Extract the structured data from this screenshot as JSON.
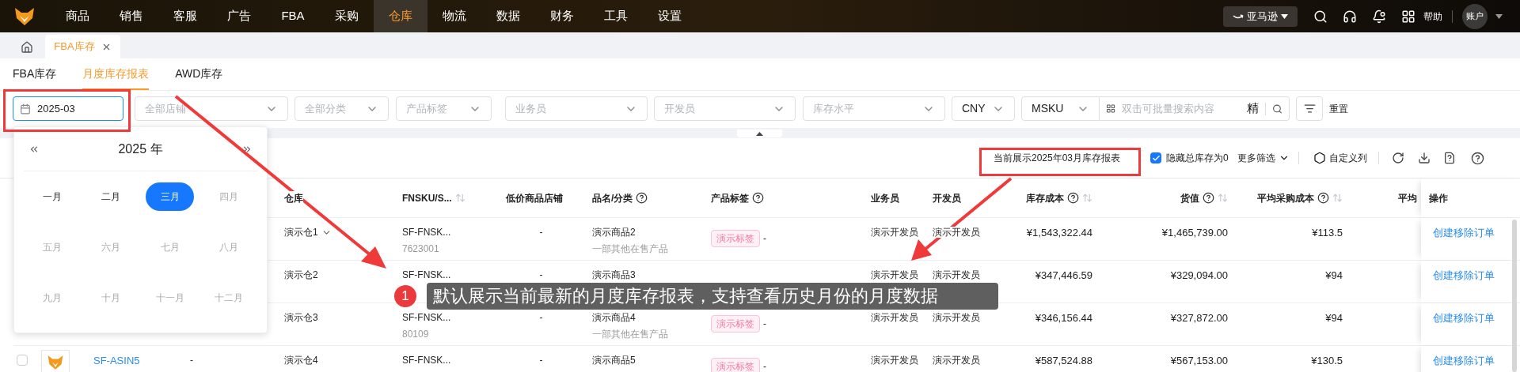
{
  "nav": {
    "items": [
      {
        "label": "商品",
        "selected": false
      },
      {
        "label": "销售",
        "selected": false
      },
      {
        "label": "客服",
        "selected": false
      },
      {
        "label": "广告",
        "selected": false
      },
      {
        "label": "FBA",
        "selected": false
      },
      {
        "label": "采购",
        "selected": false
      },
      {
        "label": "仓库",
        "selected": true
      },
      {
        "label": "物流",
        "selected": false
      },
      {
        "label": "数据",
        "selected": false
      },
      {
        "label": "财务",
        "selected": false
      },
      {
        "label": "工具",
        "selected": false
      },
      {
        "label": "设置",
        "selected": false
      }
    ],
    "marketplace": "亚马逊",
    "help": "帮助",
    "account": "账户"
  },
  "page_tabs": [
    {
      "label": "FBA库存",
      "selected": true
    }
  ],
  "sub_tabs": [
    {
      "label": "FBA库存",
      "selected": false
    },
    {
      "label": "月度库存报表",
      "selected": true
    },
    {
      "label": "AWD库存",
      "selected": false
    }
  ],
  "filters": {
    "date": "2025-03",
    "selects": [
      {
        "placeholder": "全部店铺"
      },
      {
        "placeholder": "全部分类"
      },
      {
        "placeholder": "产品标签"
      },
      {
        "placeholder": "业务员"
      },
      {
        "placeholder": "开发员"
      },
      {
        "placeholder": "库存水平"
      }
    ],
    "currency": "CNY",
    "search_type": "MSKU",
    "search_placeholder": "双击可批量搜索内容",
    "exact": "精",
    "reset": "重置"
  },
  "calendar": {
    "year": "2025 年",
    "months": [
      {
        "label": "一月",
        "selected": false,
        "disabled": false
      },
      {
        "label": "二月",
        "selected": false,
        "disabled": false
      },
      {
        "label": "三月",
        "selected": true,
        "disabled": false
      },
      {
        "label": "四月",
        "selected": false,
        "disabled": true
      },
      {
        "label": "五月",
        "selected": false,
        "disabled": true
      },
      {
        "label": "六月",
        "selected": false,
        "disabled": true
      },
      {
        "label": "七月",
        "selected": false,
        "disabled": true
      },
      {
        "label": "八月",
        "selected": false,
        "disabled": true
      },
      {
        "label": "九月",
        "selected": false,
        "disabled": true
      },
      {
        "label": "十月",
        "selected": false,
        "disabled": true
      },
      {
        "label": "十一月",
        "selected": false,
        "disabled": true
      },
      {
        "label": "十二月",
        "selected": false,
        "disabled": true
      }
    ]
  },
  "toolbar": {
    "notice": "当前展示2025年03月库存报表",
    "hide_zero": {
      "label": "隐藏总库存为0",
      "checked": true
    },
    "more_filters": "更多筛选",
    "custom_columns": "自定义列"
  },
  "table": {
    "columns": [
      {
        "label": "仓库",
        "help": false,
        "sortable": false
      },
      {
        "label": "FNSKU/S...",
        "help": false,
        "sortable": true
      },
      {
        "label": "低价商品店铺",
        "help": false,
        "sortable": false
      },
      {
        "label": "品名/分类",
        "help": true,
        "sortable": false
      },
      {
        "label": "产品标签",
        "help": true,
        "sortable": false
      },
      {
        "label": "业务员",
        "help": false,
        "sortable": false
      },
      {
        "label": "开发员",
        "help": false,
        "sortable": false
      },
      {
        "label": "库存成本",
        "help": true,
        "sortable": true
      },
      {
        "label": "货值",
        "help": true,
        "sortable": true
      },
      {
        "label": "平均采购成本",
        "help": true,
        "sortable": true
      },
      {
        "label": "平均"
      },
      {
        "label": "操作",
        "help": false,
        "sortable": false
      }
    ],
    "rows": [
      {
        "warehouse": "演示仓1",
        "expandable": true,
        "fnsku": "SF-FNSK...",
        "fnsku_sub": "7623001",
        "low_price_store": "-",
        "name": "演示商品2",
        "category": "一部其他在售产品",
        "tag": "演示标签",
        "tag_suffix": "-",
        "salesperson": "演示开发员",
        "developer": "演示开发员",
        "stock_cost": "¥1,543,322.44",
        "goods_value": "¥1,465,739.00",
        "avg_cost": "¥113.5",
        "action": "创建移除订单"
      },
      {
        "warehouse": "演示仓2",
        "expandable": false,
        "fnsku": "SF-FNSK...",
        "low_price_store": "-",
        "name": "演示商品3",
        "salesperson": "演示开发员",
        "developer": "演示开发员",
        "stock_cost": "¥347,446.59",
        "goods_value": "¥329,094.00",
        "avg_cost": "¥94",
        "action": "创建移除订单"
      },
      {
        "warehouse": "演示仓3",
        "expandable": false,
        "fnsku": "SF-FNSK...",
        "fnsku_sub": "80109",
        "low_price_store": "-",
        "name": "演示商品4",
        "category": "一部其他在售产品",
        "tag": "演示标签",
        "tag_suffix": "-",
        "salesperson": "演示开发员",
        "developer": "演示开发员",
        "stock_cost": "¥346,156.44",
        "goods_value": "¥327,872.00",
        "avg_cost": "¥94",
        "action": "创建移除订单"
      },
      {
        "checked": false,
        "asin": "SF-ASIN5",
        "column_2": "-",
        "warehouse": "演示仓4",
        "expandable": false,
        "fnsku": "SF-FNSK...",
        "low_price_store": "-",
        "name": "演示商品5",
        "tag": "演示标签",
        "tag_suffix": "-",
        "salesperson": "演示开发员",
        "developer": "演示开发员",
        "stock_cost": "¥587,524.88",
        "goods_value": "¥567,153.00",
        "avg_cost": "¥130.5",
        "action": "创建移除订单"
      }
    ]
  },
  "annotation": {
    "step": "1",
    "text": "默认展示当前最新的月度库存报表，支持查看历史月份的月度数据"
  }
}
